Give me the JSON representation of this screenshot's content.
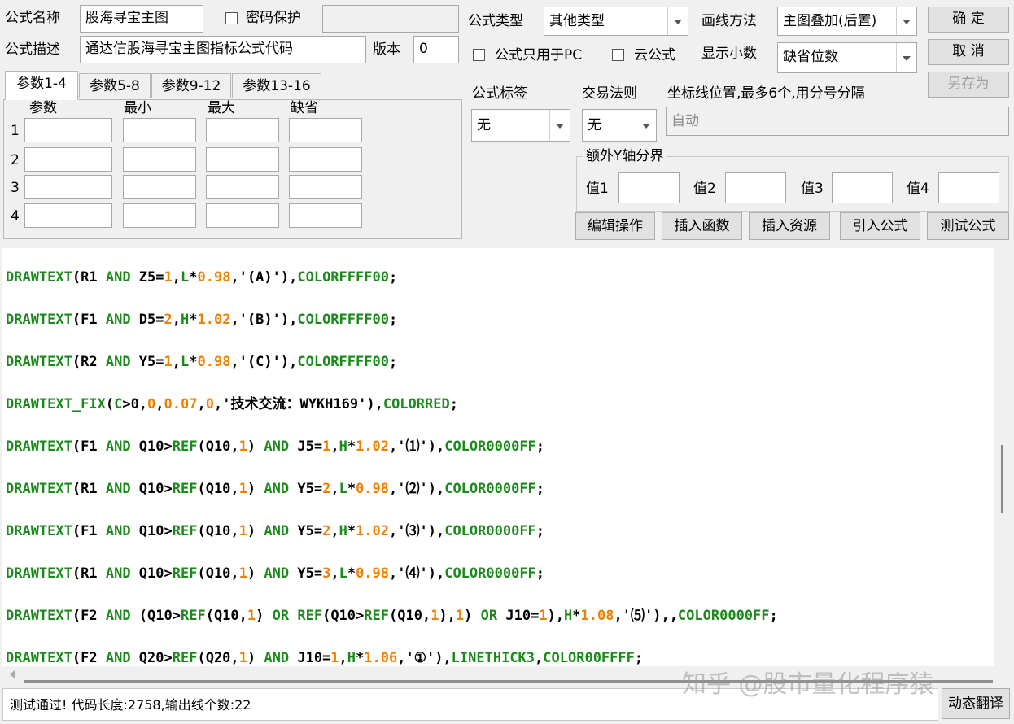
{
  "form": {
    "name_label": "公式名称",
    "name_value": "股海寻宝主图",
    "password_label": "密码保护",
    "type_label": "公式类型",
    "type_value": "其他类型",
    "draw_method_label": "画线方法",
    "draw_method_value": "主图叠加(后置)",
    "desc_label": "公式描述",
    "desc_value": "通达信股海寻宝主图指标公式代码",
    "version_label": "版本",
    "version_value": "0",
    "pc_only_label": "公式只用于PC",
    "cloud_label": "云公式",
    "decimals_label": "显示小数",
    "decimals_value": "缺省位数",
    "tag_label": "公式标签",
    "tag_value": "无",
    "rule_label": "交易法则",
    "rule_value": "无",
    "coord_label": "坐标线位置,最多6个,用分号分隔",
    "coord_value": "自动",
    "extra_y_label": "额外Y轴分界",
    "val1": "值1",
    "val2": "值2",
    "val3": "值3",
    "val4": "值4"
  },
  "buttons": {
    "ok": "确  定",
    "cancel": "取  消",
    "save_as": "另存为",
    "edit": "编辑操作",
    "insert_func": "插入函数",
    "insert_res": "插入资源",
    "import": "引入公式",
    "test": "测试公式",
    "dynamic": "动态翻译"
  },
  "tabs": [
    "参数1-4",
    "参数5-8",
    "参数9-12",
    "参数13-16"
  ],
  "params": {
    "headers": [
      "参数",
      "最小",
      "最大",
      "缺省"
    ],
    "rows": [
      "1",
      "2",
      "3",
      "4"
    ]
  },
  "code_lines": [
    [
      [
        "kw",
        "DRAWTEXT"
      ],
      [
        "id",
        "(R1 "
      ],
      [
        "kw",
        "AND"
      ],
      [
        "id",
        " Z5="
      ],
      [
        "num",
        "1"
      ],
      [
        "id",
        ","
      ],
      [
        "kw",
        "L"
      ],
      [
        "id",
        "*"
      ],
      [
        "num",
        "0.98"
      ],
      [
        "id",
        ",'(A)'),"
      ],
      [
        "col",
        "COLORFFFF00"
      ],
      [
        "id",
        ";"
      ]
    ],
    [
      [
        "kw",
        "DRAWTEXT"
      ],
      [
        "id",
        "(F1 "
      ],
      [
        "kw",
        "AND"
      ],
      [
        "id",
        " D5="
      ],
      [
        "num",
        "2"
      ],
      [
        "id",
        ","
      ],
      [
        "kw",
        "H"
      ],
      [
        "id",
        "*"
      ],
      [
        "num",
        "1.02"
      ],
      [
        "id",
        ",'(B)'),"
      ],
      [
        "col",
        "COLORFFFF00"
      ],
      [
        "id",
        ";"
      ]
    ],
    [
      [
        "kw",
        "DRAWTEXT"
      ],
      [
        "id",
        "(R2 "
      ],
      [
        "kw",
        "AND"
      ],
      [
        "id",
        " Y5="
      ],
      [
        "num",
        "1"
      ],
      [
        "id",
        ","
      ],
      [
        "kw",
        "L"
      ],
      [
        "id",
        "*"
      ],
      [
        "num",
        "0.98"
      ],
      [
        "id",
        ",'(C)'),"
      ],
      [
        "col",
        "COLORFFFF00"
      ],
      [
        "id",
        ";"
      ]
    ],
    [
      [
        "kw",
        "DRAWTEXT_FIX"
      ],
      [
        "id",
        "("
      ],
      [
        "kw",
        "C"
      ],
      [
        "id",
        ">0,"
      ],
      [
        "num",
        "0"
      ],
      [
        "id",
        ","
      ],
      [
        "num",
        "0.07"
      ],
      [
        "id",
        ","
      ],
      [
        "num",
        "0"
      ],
      [
        "id",
        ",'技术交流：WYKH169'),"
      ],
      [
        "col",
        "COLORRED"
      ],
      [
        "id",
        ";"
      ]
    ],
    [
      [
        "kw",
        "DRAWTEXT"
      ],
      [
        "id",
        "(F1 "
      ],
      [
        "kw",
        "AND"
      ],
      [
        "id",
        " Q10>"
      ],
      [
        "kw",
        "REF"
      ],
      [
        "id",
        "(Q10,"
      ],
      [
        "num",
        "1"
      ],
      [
        "id",
        ") "
      ],
      [
        "kw",
        "AND"
      ],
      [
        "id",
        " J5="
      ],
      [
        "num",
        "1"
      ],
      [
        "id",
        ","
      ],
      [
        "kw",
        "H"
      ],
      [
        "id",
        "*"
      ],
      [
        "num",
        "1.02"
      ],
      [
        "id",
        ",'⑴'),"
      ],
      [
        "col",
        "COLOR0000FF"
      ],
      [
        "id",
        ";"
      ]
    ],
    [
      [
        "kw",
        "DRAWTEXT"
      ],
      [
        "id",
        "(R1 "
      ],
      [
        "kw",
        "AND"
      ],
      [
        "id",
        " Q10>"
      ],
      [
        "kw",
        "REF"
      ],
      [
        "id",
        "(Q10,"
      ],
      [
        "num",
        "1"
      ],
      [
        "id",
        ") "
      ],
      [
        "kw",
        "AND"
      ],
      [
        "id",
        " Y5="
      ],
      [
        "num",
        "2"
      ],
      [
        "id",
        ","
      ],
      [
        "kw",
        "L"
      ],
      [
        "id",
        "*"
      ],
      [
        "num",
        "0.98"
      ],
      [
        "id",
        ",'⑵'),"
      ],
      [
        "col",
        "COLOR0000FF"
      ],
      [
        "id",
        ";"
      ]
    ],
    [
      [
        "kw",
        "DRAWTEXT"
      ],
      [
        "id",
        "(F1 "
      ],
      [
        "kw",
        "AND"
      ],
      [
        "id",
        " Q10>"
      ],
      [
        "kw",
        "REF"
      ],
      [
        "id",
        "(Q10,"
      ],
      [
        "num",
        "1"
      ],
      [
        "id",
        ") "
      ],
      [
        "kw",
        "AND"
      ],
      [
        "id",
        " Y5="
      ],
      [
        "num",
        "2"
      ],
      [
        "id",
        ","
      ],
      [
        "kw",
        "H"
      ],
      [
        "id",
        "*"
      ],
      [
        "num",
        "1.02"
      ],
      [
        "id",
        ",'⑶'),"
      ],
      [
        "col",
        "COLOR0000FF"
      ],
      [
        "id",
        ";"
      ]
    ],
    [
      [
        "kw",
        "DRAWTEXT"
      ],
      [
        "id",
        "(R1 "
      ],
      [
        "kw",
        "AND"
      ],
      [
        "id",
        " Q10>"
      ],
      [
        "kw",
        "REF"
      ],
      [
        "id",
        "(Q10,"
      ],
      [
        "num",
        "1"
      ],
      [
        "id",
        ") "
      ],
      [
        "kw",
        "AND"
      ],
      [
        "id",
        " Y5="
      ],
      [
        "num",
        "3"
      ],
      [
        "id",
        ","
      ],
      [
        "kw",
        "L"
      ],
      [
        "id",
        "*"
      ],
      [
        "num",
        "0.98"
      ],
      [
        "id",
        ",'⑷'),"
      ],
      [
        "col",
        "COLOR0000FF"
      ],
      [
        "id",
        ";"
      ]
    ],
    [
      [
        "kw",
        "DRAWTEXT"
      ],
      [
        "id",
        "(F2 "
      ],
      [
        "kw",
        "AND"
      ],
      [
        "id",
        " (Q10>"
      ],
      [
        "kw",
        "REF"
      ],
      [
        "id",
        "(Q10,"
      ],
      [
        "num",
        "1"
      ],
      [
        "id",
        ") "
      ],
      [
        "kw",
        "OR"
      ],
      [
        "id",
        " "
      ],
      [
        "kw",
        "REF"
      ],
      [
        "id",
        "(Q10>"
      ],
      [
        "kw",
        "REF"
      ],
      [
        "id",
        "(Q10,"
      ],
      [
        "num",
        "1"
      ],
      [
        "id",
        "),"
      ],
      [
        "num",
        "1"
      ],
      [
        "id",
        ") "
      ],
      [
        "kw",
        "OR"
      ],
      [
        "id",
        " J10="
      ],
      [
        "num",
        "1"
      ],
      [
        "id",
        "),"
      ],
      [
        "kw",
        "H"
      ],
      [
        "id",
        "*"
      ],
      [
        "num",
        "1.08"
      ],
      [
        "id",
        ",'⑸'),,"
      ],
      [
        "col",
        "COLOR0000FF"
      ],
      [
        "id",
        ";"
      ]
    ],
    [
      [
        "kw",
        "DRAWTEXT"
      ],
      [
        "id",
        "(F2 "
      ],
      [
        "kw",
        "AND"
      ],
      [
        "id",
        " Q20>"
      ],
      [
        "kw",
        "REF"
      ],
      [
        "id",
        "(Q20,"
      ],
      [
        "num",
        "1"
      ],
      [
        "id",
        ") "
      ],
      [
        "kw",
        "AND"
      ],
      [
        "id",
        " J10="
      ],
      [
        "num",
        "1"
      ],
      [
        "id",
        ","
      ],
      [
        "kw",
        "H"
      ],
      [
        "id",
        "*"
      ],
      [
        "num",
        "1.06"
      ],
      [
        "id",
        ",'①'),"
      ],
      [
        "col",
        "LINETHICK3"
      ],
      [
        "id",
        ","
      ],
      [
        "col",
        "COLOR00FFFF"
      ],
      [
        "id",
        ";"
      ]
    ]
  ],
  "status_text": "测试通过! 代码长度:2758,输出线个数:22",
  "watermark": "知乎 @股市量化程序猿"
}
